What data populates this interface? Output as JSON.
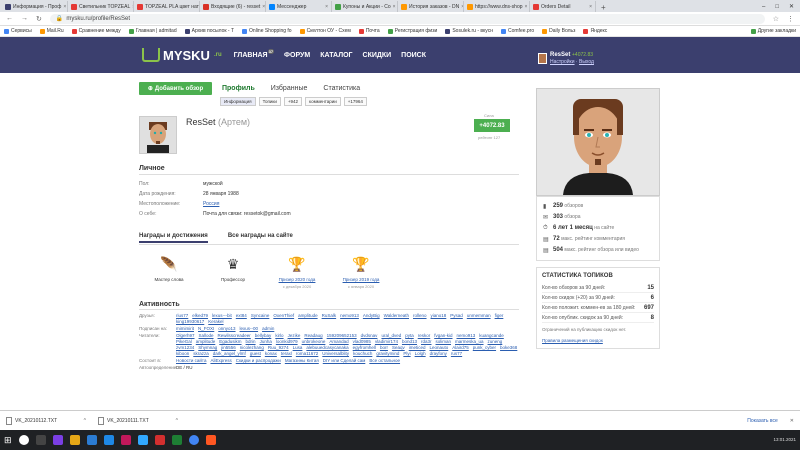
{
  "browser": {
    "tabs": [
      {
        "label": "Информация - Проф",
        "color": "#3b3f6e",
        "active": false
      },
      {
        "label": "Светильник TOPZEAL",
        "color": "#e53935",
        "active": false
      },
      {
        "label": "TOPZEAL PLA цвет нат",
        "color": "#e53935",
        "active": false
      },
      {
        "label": "Входящие (6) - resset",
        "color": "#d93025",
        "active": false
      },
      {
        "label": "Мессенджер",
        "color": "#0084ff",
        "active": false
      },
      {
        "label": "Купоны и Акции - Со",
        "color": "#43a047",
        "active": false
      },
      {
        "label": "История заказов - DN",
        "color": "#ff9800",
        "active": false
      },
      {
        "label": "https://www.dns-shop",
        "color": "#ff9800",
        "active": false
      },
      {
        "label": "Orders Detail",
        "color": "#e53935",
        "active": false
      }
    ],
    "url": "mysku.ru/profile/ResSet",
    "bookmarks": [
      "Сервисы",
      "Mail.Ru",
      "Сравнение между",
      "Главная | admitad",
      "Архив посылок - Т",
      "Online Shopping fo",
      "Скелтон ОУ - Схем",
      "Почта",
      "Регистрация физи",
      "Sosulek.ru - вкусн",
      "Comfee.pro",
      "Daily Вольз",
      "Яндекс",
      "Другие закладки"
    ]
  },
  "site": {
    "logo": "MYSKU",
    "logo_suffix": ".ru",
    "nav": [
      {
        "label": "ГЛАВНАЯ",
        "sup": "37"
      },
      {
        "label": "ФОРУМ",
        "sup": ""
      },
      {
        "label": "КАТАЛОГ",
        "sup": ""
      },
      {
        "label": "СКИДКИ",
        "sup": ""
      },
      {
        "label": "ПОИСК",
        "sup": ""
      }
    ],
    "user": {
      "name": "ResSet",
      "balance": "+4072.83",
      "settings": "Настройки",
      "logout": "Выход"
    }
  },
  "profile": {
    "add_review": "Добавить обзор",
    "tabs": [
      "Профиль",
      "Избранные",
      "Статистика"
    ],
    "subtabs": [
      "Информация",
      "Топики",
      "+942",
      "комментарии",
      "+17964"
    ],
    "login": "ResSet",
    "realname": "(Артем)",
    "rating_label": "Сила",
    "rating": "+4072.83",
    "rating_sub": "рейтинг 127",
    "personal_title": "Личное",
    "personal": [
      {
        "k": "Пол:",
        "v": "мужской",
        "link": false
      },
      {
        "k": "Дата рождения:",
        "v": "28 января 1988",
        "link": false
      },
      {
        "k": "Местоположение:",
        "v": "Россия",
        "link": true
      },
      {
        "k": "О себе:",
        "v": "Почта для связи: ressetok@gmail.com",
        "link": false
      }
    ],
    "awards_tabs": [
      "Награды и достижения",
      "Все награды на сайте"
    ],
    "awards": [
      {
        "icon": "🪶",
        "name": "Мастер слова",
        "date": "",
        "link": false
      },
      {
        "icon": "♛",
        "name": "Профессор",
        "date": "",
        "link": false
      },
      {
        "icon": "🏆",
        "name": "Призер 2020 года",
        "date": "с декабря 2020",
        "link": true
      },
      {
        "icon": "🏆",
        "name": "Призер 2019 года",
        "date": "с января 2020",
        "link": true
      }
    ],
    "activity_title": "Активность",
    "activity": [
      {
        "k": "Друзья:",
        "v": [
          "rius77",
          "elked79",
          "lexus---bit",
          "ext84",
          "Syncaine",
          "OxenThief",
          "amplitude",
          "RuSalk",
          "nemo913",
          "AndyBig",
          "Walderneath",
          "rolleno",
          "yiano18",
          "Pysad",
          "unmemman",
          "figer",
          "king19930617",
          "Kerakel"
        ]
      },
      {
        "k": "Подписан на:",
        "v": [
          "mimimirit",
          "N_FOXI",
          "onnyo13",
          "lexus--00",
          "admin"
        ]
      },
      {
        "k": "Читатели:",
        "v": [
          "Olgerh97",
          "Sallode",
          "Rewilsscreadeer",
          "bellybay",
          "kirlo",
          "Jezike",
          "Readaug",
          "159209652153",
          "dvdsnav",
          "ural_dved",
          "pyta",
          "reskor",
          "fvgan-kid",
          "nemo913",
          "kuangcande",
          "PikeGal",
          "amplitude",
          "Egadusikm",
          "bdrin",
          "Junha",
          "loonkid979",
          "unbrokeone",
          "Amandad",
          "vlad0985",
          "vladimir174",
          "bond13",
          "rda3r",
          "soliman",
          "marmeska_ua",
          "zuneng",
          "zvm1234",
          "Shymnag",
          "jin5556",
          "nicolezhang",
          "Ruu_9274",
          "Lusa",
          "alebuuedcasycanaka",
          "egyfromhell",
          "borr",
          "Seaqv",
          "imeticed",
          "Leonauto",
          "Alaird75",
          "punk_cyber",
          "boke368",
          "kiboon",
          "skrazza",
          "dark_angel_ylmf",
          "guest",
          "konax",
          "teraxl",
          "roma11672",
          "Universalblity",
          "kouchuch",
          "gravitymind",
          "Plyi",
          "Lolgh",
          "drayfony",
          "rus77"
        ]
      },
      {
        "k": "Состоит в:",
        "v": [
          "Новости сайта",
          "AliExpress",
          "Скидки и распродажи",
          "Магазины Китая",
          "DIY или Сделай сам",
          "Все остальное"
        ]
      },
      {
        "k": "Автоопределение",
        "v": [
          "DE / RU"
        ]
      }
    ],
    "stats": [
      {
        "icon": "▮",
        "value": "259",
        "label": "обзоров"
      },
      {
        "icon": "✉",
        "value": "303",
        "label": "обзора"
      },
      {
        "icon": "⏱",
        "value": "6 лет 1 месяц",
        "label": "на сайте"
      },
      {
        "icon": "▤",
        "value": "72",
        "label": "макс. рейтинг комментария"
      },
      {
        "icon": "▤",
        "value": "504",
        "label": "макс. рейтинг обзора или видео"
      }
    ],
    "topics_title": "СТАТИСТИКА ТОПИКОВ",
    "topics": [
      {
        "k": "Кол-во обзоров за 90 дней:",
        "v": "15"
      },
      {
        "k": "Кол-во скидок (+20) за 90 дней:",
        "v": "6"
      },
      {
        "k": "Кол-во положит. коммен-ев за 180 дней:",
        "v": "697"
      },
      {
        "k": "Кол-во опублик. скидок за 90 дней:",
        "v": "8"
      }
    ],
    "topics_note": "Ограничений на публикацию скидок нет.",
    "topics_link": "Правила размещения скидок"
  },
  "downloads": {
    "files": [
      "VK_20210112.TXT",
      "VK_20210111.TXT"
    ],
    "show_all": "Показать все"
  },
  "taskbar": {
    "time": "13:01.2021"
  }
}
